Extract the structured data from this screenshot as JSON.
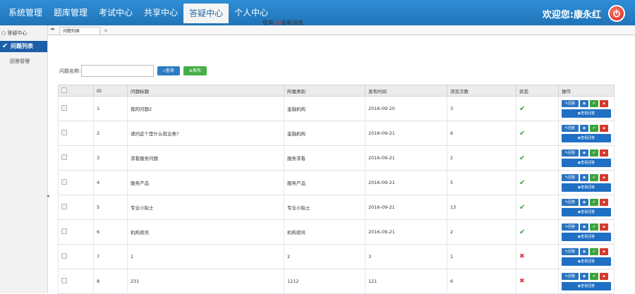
{
  "nav": {
    "items": [
      "系统管理",
      "题库管理",
      "考试中心",
      "共享中心",
      "答疑中心",
      "个人中心"
    ],
    "active": "答疑中心"
  },
  "header": {
    "welcome": "欢迎您:康永红",
    "message_prefix": "您有",
    "message_count": "16",
    "message_suffix": "条新消息"
  },
  "sidebar": {
    "title": "答疑中心",
    "active_item": "问题列表",
    "items": [
      "回答管理"
    ]
  },
  "tabs": [
    {
      "label": "问题列表"
    }
  ],
  "search": {
    "label": "问题名称:",
    "value": "",
    "placeholder": "",
    "query_button": "查询",
    "publish_button": "发布"
  },
  "table": {
    "columns": [
      "ID",
      "问题标题",
      "所属类别",
      "发布时间",
      "浏览次数",
      "状态",
      "操作"
    ],
    "rows": [
      {
        "id": "1",
        "title": "我的问题2",
        "category": "金融机构",
        "date": "2016-09-20",
        "views": "3",
        "status": "ok"
      },
      {
        "id": "2",
        "title": "请问这个是什么就业类?",
        "category": "金融机构",
        "date": "2016-09-21",
        "views": "6",
        "status": "ok"
      },
      {
        "id": "3",
        "title": "求看服务问题",
        "category": "服务求看",
        "date": "2016-09-21",
        "views": "2",
        "status": "ok"
      },
      {
        "id": "4",
        "title": "服务产品",
        "category": "服务产品",
        "date": "2016-09-21",
        "views": "5",
        "status": "ok"
      },
      {
        "id": "5",
        "title": "专业小贴士",
        "category": "专业小贴士",
        "date": "2016-09-21",
        "views": "13",
        "status": "ok"
      },
      {
        "id": "6",
        "title": "机构资讯",
        "category": "机构资讯",
        "date": "2016-09-21",
        "views": "2",
        "status": "ok"
      },
      {
        "id": "7",
        "title": "1",
        "category": "2",
        "date": "3",
        "views": "1",
        "status": "no"
      },
      {
        "id": "8",
        "title": "231",
        "category": "1212",
        "date": "121",
        "views": "6",
        "status": "no"
      }
    ],
    "actions": {
      "answer": "回答",
      "view_answer": "查看回答"
    }
  },
  "colors": {
    "nav_bg": "#2f8ed6",
    "sidebar_active": "#1d5ea8",
    "primary_button": "#2d7cc4",
    "success_button": "#46ae46",
    "danger_button": "#d33a2c",
    "status_ok": "#3aa33a",
    "status_no": "#e03838"
  }
}
